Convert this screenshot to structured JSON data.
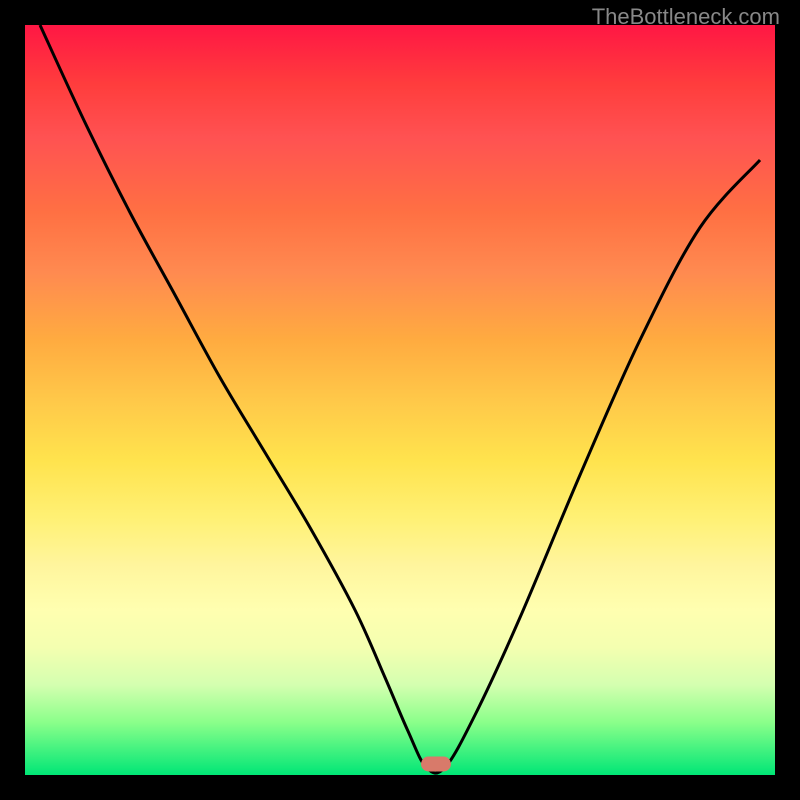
{
  "watermark": "TheBottleneck.com",
  "chart_data": {
    "type": "line",
    "title": "",
    "xlabel": "",
    "ylabel": "",
    "xlim": [
      0,
      100
    ],
    "ylim": [
      0,
      100
    ],
    "gradient_stops": [
      {
        "pct": 0,
        "color": "#ff1744"
      },
      {
        "pct": 25,
        "color": "#ff7043"
      },
      {
        "pct": 50,
        "color": "#ffc849"
      },
      {
        "pct": 75,
        "color": "#fff59d"
      },
      {
        "pct": 100,
        "color": "#00e676"
      }
    ],
    "series": [
      {
        "name": "bottleneck-curve",
        "x": [
          2,
          8,
          14,
          20,
          26,
          32,
          38,
          44,
          48,
          51,
          53.5,
          56,
          60,
          66,
          74,
          82,
          90,
          98
        ],
        "values": [
          100,
          87,
          75,
          64,
          53,
          43,
          33,
          22,
          13,
          6,
          1,
          1,
          8,
          21,
          40,
          58,
          73,
          82
        ]
      }
    ],
    "marker": {
      "x": 54.8,
      "y": 1.5
    }
  }
}
